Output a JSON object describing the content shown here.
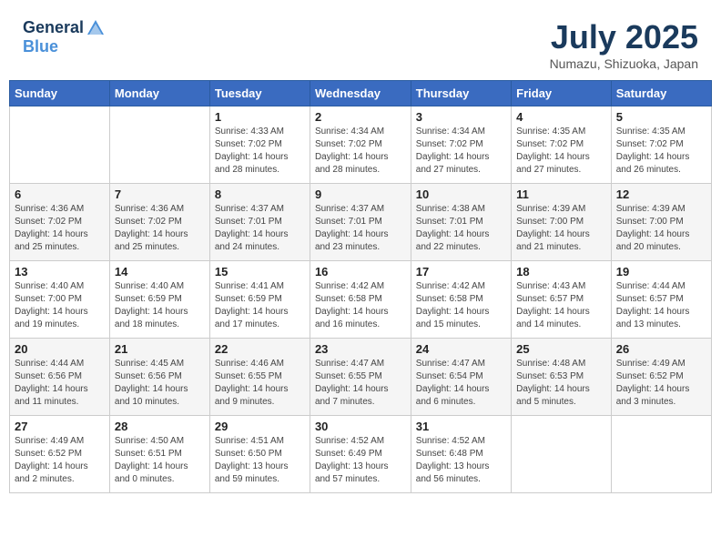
{
  "header": {
    "logo_line1": "General",
    "logo_line2": "Blue",
    "month_title": "July 2025",
    "location": "Numazu, Shizuoka, Japan"
  },
  "days_of_week": [
    "Sunday",
    "Monday",
    "Tuesday",
    "Wednesday",
    "Thursday",
    "Friday",
    "Saturday"
  ],
  "weeks": [
    [
      {
        "day": "",
        "info": ""
      },
      {
        "day": "",
        "info": ""
      },
      {
        "day": "1",
        "info": "Sunrise: 4:33 AM\nSunset: 7:02 PM\nDaylight: 14 hours\nand 28 minutes."
      },
      {
        "day": "2",
        "info": "Sunrise: 4:34 AM\nSunset: 7:02 PM\nDaylight: 14 hours\nand 28 minutes."
      },
      {
        "day": "3",
        "info": "Sunrise: 4:34 AM\nSunset: 7:02 PM\nDaylight: 14 hours\nand 27 minutes."
      },
      {
        "day": "4",
        "info": "Sunrise: 4:35 AM\nSunset: 7:02 PM\nDaylight: 14 hours\nand 27 minutes."
      },
      {
        "day": "5",
        "info": "Sunrise: 4:35 AM\nSunset: 7:02 PM\nDaylight: 14 hours\nand 26 minutes."
      }
    ],
    [
      {
        "day": "6",
        "info": "Sunrise: 4:36 AM\nSunset: 7:02 PM\nDaylight: 14 hours\nand 25 minutes."
      },
      {
        "day": "7",
        "info": "Sunrise: 4:36 AM\nSunset: 7:02 PM\nDaylight: 14 hours\nand 25 minutes."
      },
      {
        "day": "8",
        "info": "Sunrise: 4:37 AM\nSunset: 7:01 PM\nDaylight: 14 hours\nand 24 minutes."
      },
      {
        "day": "9",
        "info": "Sunrise: 4:37 AM\nSunset: 7:01 PM\nDaylight: 14 hours\nand 23 minutes."
      },
      {
        "day": "10",
        "info": "Sunrise: 4:38 AM\nSunset: 7:01 PM\nDaylight: 14 hours\nand 22 minutes."
      },
      {
        "day": "11",
        "info": "Sunrise: 4:39 AM\nSunset: 7:00 PM\nDaylight: 14 hours\nand 21 minutes."
      },
      {
        "day": "12",
        "info": "Sunrise: 4:39 AM\nSunset: 7:00 PM\nDaylight: 14 hours\nand 20 minutes."
      }
    ],
    [
      {
        "day": "13",
        "info": "Sunrise: 4:40 AM\nSunset: 7:00 PM\nDaylight: 14 hours\nand 19 minutes."
      },
      {
        "day": "14",
        "info": "Sunrise: 4:40 AM\nSunset: 6:59 PM\nDaylight: 14 hours\nand 18 minutes."
      },
      {
        "day": "15",
        "info": "Sunrise: 4:41 AM\nSunset: 6:59 PM\nDaylight: 14 hours\nand 17 minutes."
      },
      {
        "day": "16",
        "info": "Sunrise: 4:42 AM\nSunset: 6:58 PM\nDaylight: 14 hours\nand 16 minutes."
      },
      {
        "day": "17",
        "info": "Sunrise: 4:42 AM\nSunset: 6:58 PM\nDaylight: 14 hours\nand 15 minutes."
      },
      {
        "day": "18",
        "info": "Sunrise: 4:43 AM\nSunset: 6:57 PM\nDaylight: 14 hours\nand 14 minutes."
      },
      {
        "day": "19",
        "info": "Sunrise: 4:44 AM\nSunset: 6:57 PM\nDaylight: 14 hours\nand 13 minutes."
      }
    ],
    [
      {
        "day": "20",
        "info": "Sunrise: 4:44 AM\nSunset: 6:56 PM\nDaylight: 14 hours\nand 11 minutes."
      },
      {
        "day": "21",
        "info": "Sunrise: 4:45 AM\nSunset: 6:56 PM\nDaylight: 14 hours\nand 10 minutes."
      },
      {
        "day": "22",
        "info": "Sunrise: 4:46 AM\nSunset: 6:55 PM\nDaylight: 14 hours\nand 9 minutes."
      },
      {
        "day": "23",
        "info": "Sunrise: 4:47 AM\nSunset: 6:55 PM\nDaylight: 14 hours\nand 7 minutes."
      },
      {
        "day": "24",
        "info": "Sunrise: 4:47 AM\nSunset: 6:54 PM\nDaylight: 14 hours\nand 6 minutes."
      },
      {
        "day": "25",
        "info": "Sunrise: 4:48 AM\nSunset: 6:53 PM\nDaylight: 14 hours\nand 5 minutes."
      },
      {
        "day": "26",
        "info": "Sunrise: 4:49 AM\nSunset: 6:52 PM\nDaylight: 14 hours\nand 3 minutes."
      }
    ],
    [
      {
        "day": "27",
        "info": "Sunrise: 4:49 AM\nSunset: 6:52 PM\nDaylight: 14 hours\nand 2 minutes."
      },
      {
        "day": "28",
        "info": "Sunrise: 4:50 AM\nSunset: 6:51 PM\nDaylight: 14 hours\nand 0 minutes."
      },
      {
        "day": "29",
        "info": "Sunrise: 4:51 AM\nSunset: 6:50 PM\nDaylight: 13 hours\nand 59 minutes."
      },
      {
        "day": "30",
        "info": "Sunrise: 4:52 AM\nSunset: 6:49 PM\nDaylight: 13 hours\nand 57 minutes."
      },
      {
        "day": "31",
        "info": "Sunrise: 4:52 AM\nSunset: 6:48 PM\nDaylight: 13 hours\nand 56 minutes."
      },
      {
        "day": "",
        "info": ""
      },
      {
        "day": "",
        "info": ""
      }
    ]
  ]
}
